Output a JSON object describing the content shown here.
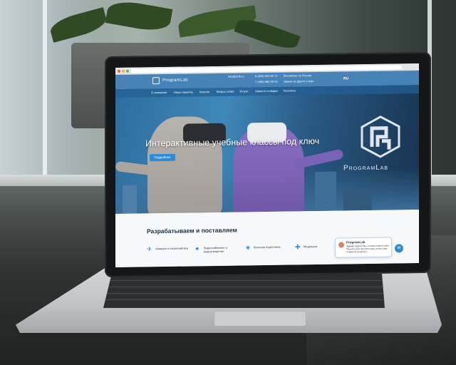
{
  "site": {
    "logo_text": "ProgramLab",
    "email": "info@pl-lb.ru",
    "phone_main": "8 (800) 550 89 72",
    "phone_region": "7 (499) 685 02 00",
    "phone_note_1": "бесплатно по России",
    "phone_note_2": "звонки из других стран",
    "lang": "RU"
  },
  "nav": {
    "items": [
      "О компании",
      "Наши проекты",
      "Каталог",
      "Вопрос-ответ",
      "Услуги",
      "Новости и медиа",
      "Контакты"
    ]
  },
  "hero": {
    "title": "Интерактивные учебные классы под ключ",
    "button": "Подробнее",
    "brand": "ProgramLab"
  },
  "section": {
    "title": "Разрабатываем и поставляем",
    "categories": [
      {
        "icon": "plane-icon",
        "label": "Авиация и космонавтика"
      },
      {
        "icon": "drop-icon",
        "label": "Водоснабжение и водоотведение"
      },
      {
        "icon": "star-icon",
        "label": "Военная подготовка"
      },
      {
        "icon": "medic-icon",
        "label": "Медицина"
      }
    ]
  },
  "chat": {
    "name": "ProgramLab",
    "message": "Здравствуйте! Мы готовы помочь вам. Пишите или звоните нам, если у вас появятся вопросы."
  },
  "colors": {
    "header_blue": "#286eaa",
    "accent": "#2f8ad6",
    "heading": "#1d2f44"
  }
}
